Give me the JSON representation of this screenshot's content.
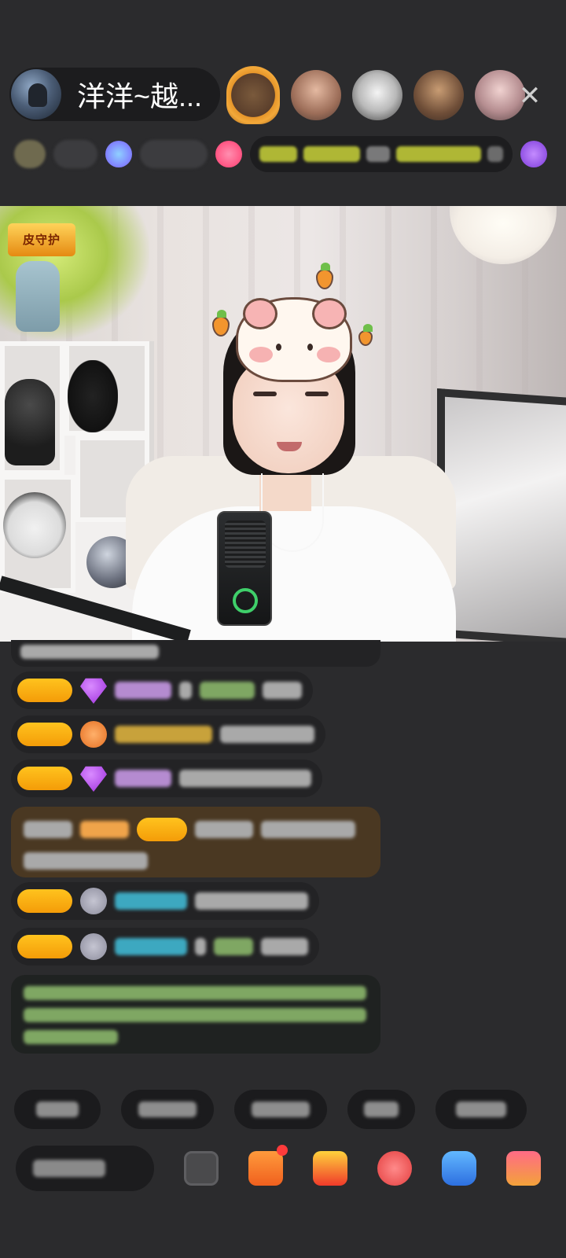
{
  "header": {
    "host_name": "洋洋~越...",
    "close_glyph": "✕"
  },
  "video": {
    "badge_text": "皮守护"
  }
}
